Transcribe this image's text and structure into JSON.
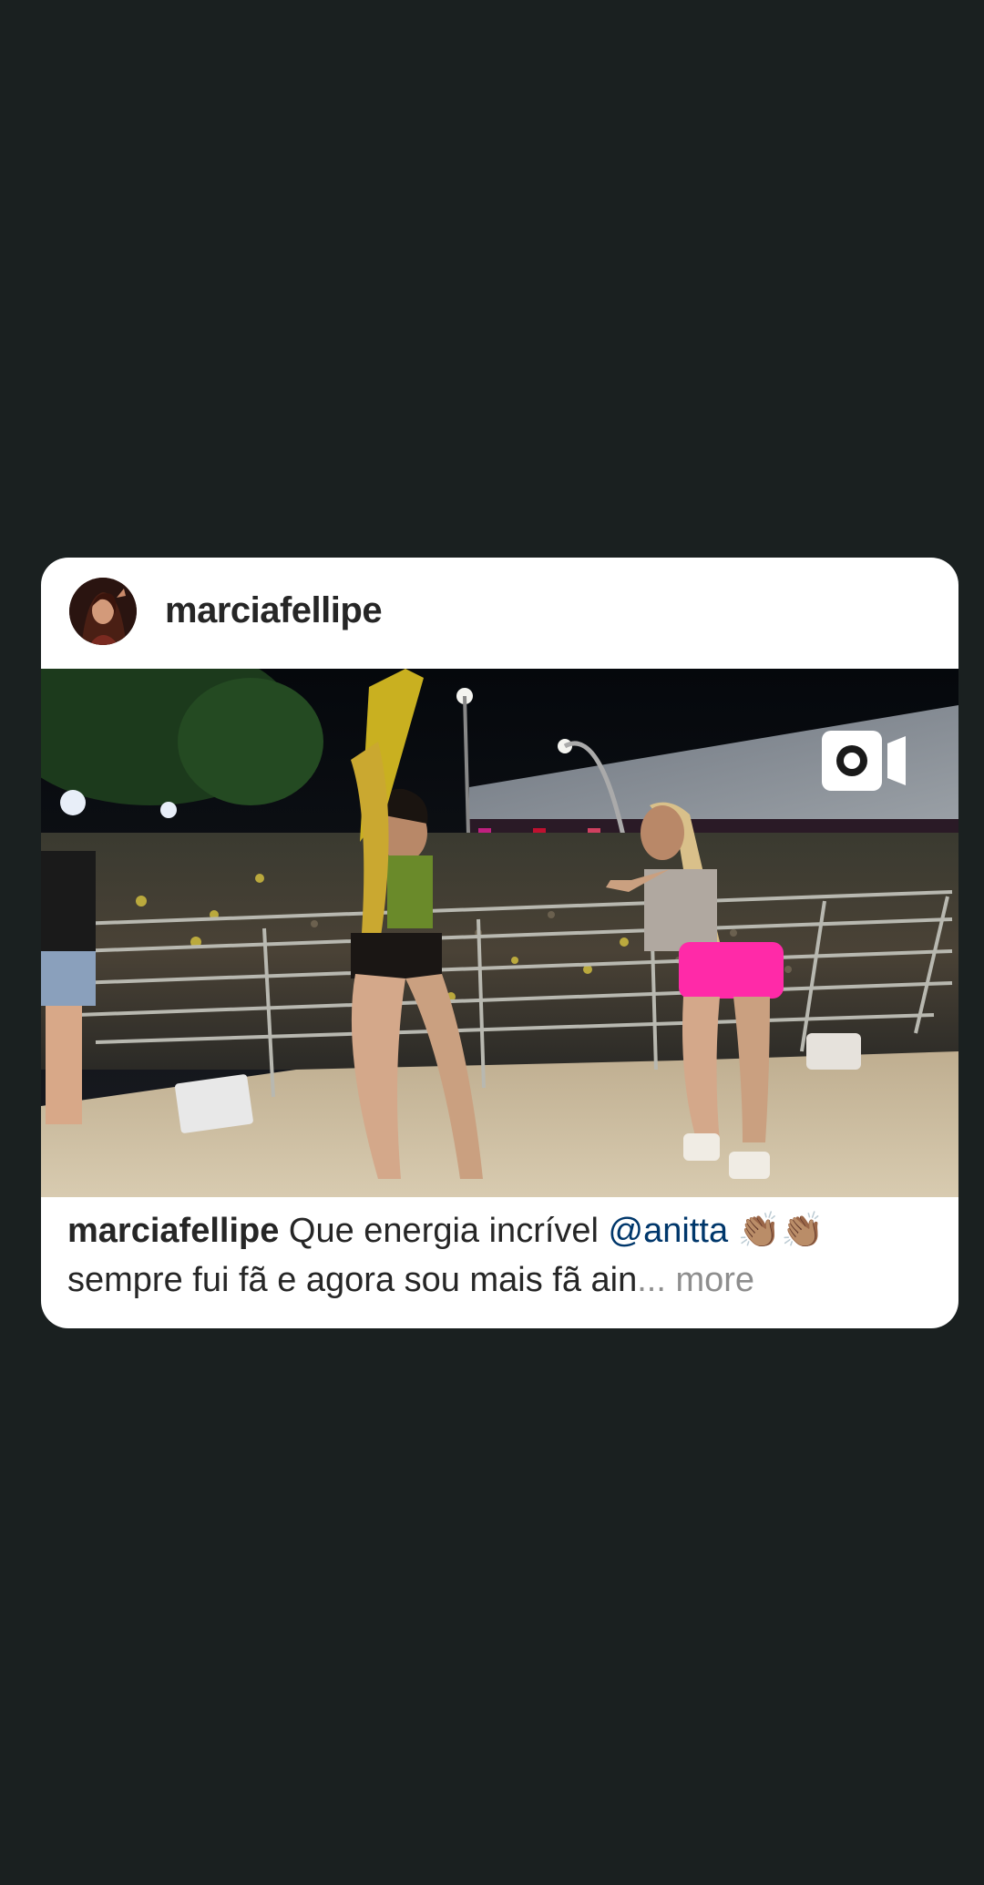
{
  "post": {
    "username": "marciafellipe",
    "caption": {
      "username": "marciafellipe",
      "text_before": "Que energia incrível",
      "mention": "@anitta",
      "emoji": "👏🏽👏🏽",
      "line2": "sempre fui fã e agora sou mais fã ain",
      "ellipsis": "...",
      "more_label": "more"
    },
    "media": {
      "type_icon": "igtv-icon",
      "description_icon": "video-thumbnail"
    }
  },
  "colors": {
    "background": "#1a2020",
    "card": "#ffffff",
    "text": "#262626",
    "mention": "#00376b",
    "more": "#8e8e8e"
  }
}
